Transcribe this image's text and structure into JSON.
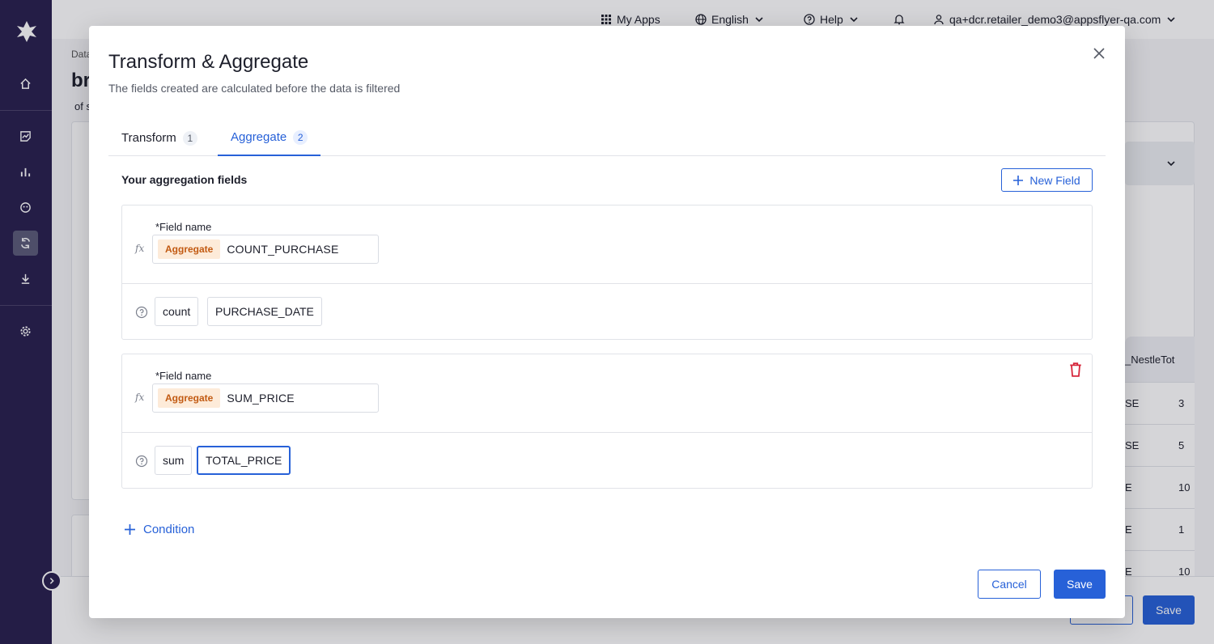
{
  "topbar": {
    "my_apps": "My Apps",
    "language": "English",
    "help": "Help",
    "user": "qa+dcr.retailer_demo3@appsflyer-qa.com"
  },
  "background": {
    "breadcrumb": "Data",
    "title": "br",
    "subtitle": "of s",
    "table_headers": [
      "_Nestle",
      "Tot"
    ],
    "table_rows": [
      [
        "SE",
        "3"
      ],
      [
        "SE",
        "5"
      ],
      [
        "E",
        "10"
      ],
      [
        "E",
        "1"
      ],
      [
        "E",
        "10"
      ]
    ],
    "save_label": "Save"
  },
  "modal": {
    "title": "Transform & Aggregate",
    "subtitle": "The fields created are calculated before the data is filtered",
    "tabs": [
      {
        "label": "Transform",
        "count": "1",
        "active": false
      },
      {
        "label": "Aggregate",
        "count": "2",
        "active": true
      }
    ],
    "section_title": "Your aggregation fields",
    "new_field_label": "New Field",
    "fields": [
      {
        "label": "*Field name",
        "chip": "Aggregate",
        "name": "COUNT_PURCHASE",
        "function": "count",
        "column": "PURCHASE_DATE",
        "deletable": false
      },
      {
        "label": "*Field name",
        "chip": "Aggregate",
        "name": "SUM_PRICE",
        "function": "sum",
        "column": "TOTAL_PRICE",
        "deletable": true
      }
    ],
    "condition_label": "Condition",
    "cancel_label": "Cancel",
    "save_label": "Save"
  },
  "icons": {
    "fx": "fx"
  },
  "colors": {
    "sidebar": "#281f4d",
    "primary": "#2761d8",
    "aggregate_chip_bg": "#fdebd9",
    "aggregate_chip_text": "#c25a12",
    "delete": "#d6263b"
  }
}
